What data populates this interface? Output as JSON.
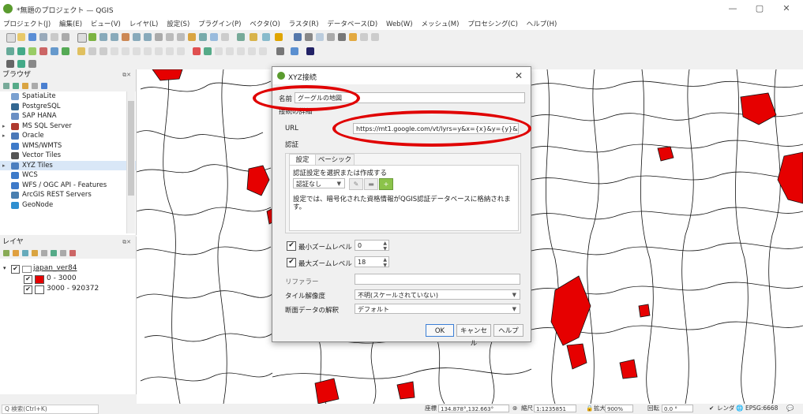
{
  "window": {
    "title": "*無題のプロジェクト — QGIS",
    "minimize": "—",
    "maximize": "▢",
    "close": "✕"
  },
  "menu": [
    "プロジェクト(J)",
    "編集(E)",
    "ビュー(V)",
    "レイヤ(L)",
    "設定(S)",
    "プラグイン(P)",
    "ベクタ(O)",
    "ラスタ(R)",
    "データベース(D)",
    "Web(W)",
    "メッシュ(M)",
    "プロセシング(C)",
    "ヘルプ(H)"
  ],
  "browser": {
    "title": "ブラウザ",
    "items": [
      {
        "label": "SpatiaLite",
        "icon": "spatialite-icon",
        "color": "#7aa0d0"
      },
      {
        "label": "PostgreSQL",
        "icon": "postgresql-icon",
        "color": "#336791"
      },
      {
        "label": "SAP HANA",
        "icon": "sap-hana-icon",
        "color": "#6a8fc4"
      },
      {
        "label": "MS SQL Server",
        "icon": "mssql-icon",
        "color": "#b03a2e"
      },
      {
        "label": "Oracle",
        "icon": "oracle-icon",
        "color": "#4a78b8"
      },
      {
        "label": "WMS/WMTS",
        "icon": "wms-icon",
        "color": "#3d7ac9"
      },
      {
        "label": "Vector Tiles",
        "icon": "vector-tiles-icon",
        "color": "#555555"
      },
      {
        "label": "XYZ Tiles",
        "icon": "xyz-tiles-icon",
        "color": "#4c7fbf"
      },
      {
        "label": "WCS",
        "icon": "wcs-icon",
        "color": "#3d7ac9"
      },
      {
        "label": "WFS / OGC API - Features",
        "icon": "wfs-icon",
        "color": "#3d7ac9"
      },
      {
        "label": "ArcGIS REST Servers",
        "icon": "arcgis-icon",
        "color": "#4a7fb0"
      },
      {
        "label": "GeoNode",
        "icon": "geonode-icon",
        "color": "#2f8fd0"
      }
    ]
  },
  "layers": {
    "title": "レイヤ",
    "group": "japan_ver84",
    "classes": [
      {
        "label": "0 - 3000",
        "color": "#e60000",
        "checked": "✔"
      },
      {
        "label": "3000 - 920372",
        "color": "#ffffff",
        "checked": "✔"
      }
    ]
  },
  "dialog": {
    "title": "XYZ接続",
    "close": "✕",
    "name_label": "名前",
    "name_value": "グーグルの地図",
    "section_label": "接続の詳細",
    "url_label": "URL",
    "url_value": "https://mt1.google.com/vt/lyrs=y&x={x}&y={y}&z={z}",
    "auth_label": "認証",
    "tabs": [
      "設定",
      "ベーシック"
    ],
    "auth_select_label": "認証設定を選択または作成する",
    "auth_select_value": "認証なし",
    "auth_note": "設定では、暗号化された資格情報がQGIS認証データベースに格納されます。",
    "min_zoom_label": "最小ズームレベル",
    "min_zoom_value": "0",
    "max_zoom_label": "最大ズームレベル",
    "max_zoom_value": "18",
    "referer_label": "リファラー",
    "referer_value": "",
    "tile_res_label": "タイル解像度",
    "tile_res_value": "不明(スケールされていない)",
    "interp_label": "断面データの解釈",
    "interp_value": "デフォルト",
    "ok": "OK",
    "cancel": "キャンセル",
    "help": "ヘルプ",
    "check": "✔"
  },
  "statusbar": {
    "search_placeholder": "Q 検索(Ctrl+K)",
    "coord_label": "座標",
    "coord_value": "134.878°,132.663°",
    "scale_label": "縮尺",
    "scale_value": "1:1235851",
    "magnify_label": "拡大",
    "magnify_value": "900%",
    "rotation_label": "回転",
    "rotation_value": "0.0 °",
    "render_label": "レンダ",
    "crs": "EPSG:6668"
  },
  "colors": {
    "highlight": "#e00000",
    "region_fill": "#e60000",
    "accent": "#5a9b2e"
  }
}
